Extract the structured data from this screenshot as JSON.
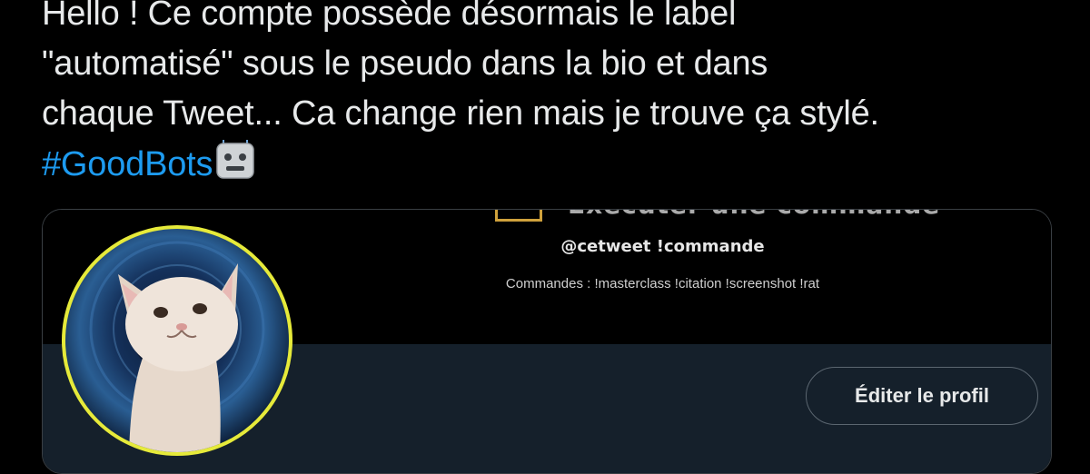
{
  "tweet": {
    "line1": "Hello ! Ce compte possède désormais le label",
    "line2": "\"automatisé\" sous le pseudo dans la bio et dans",
    "line3": "chaque Tweet... Ca change rien mais je trouve ça stylé.",
    "hashtag": "#GoodBots",
    "emoji": "robot-face-icon"
  },
  "card": {
    "banner_heading": "Exécuter une commande",
    "handle_command": "@cetweet !commande",
    "commands_line": "Commandes : !masterclass !citation !screenshot !rat",
    "edit_profile_label": "Éditer le profil"
  },
  "colors": {
    "background": "#000000",
    "text": "#e7e9ea",
    "hashtag": "#1d9bf0",
    "profile_area": "#15202b",
    "avatar_ring": "#e6ea3a"
  }
}
